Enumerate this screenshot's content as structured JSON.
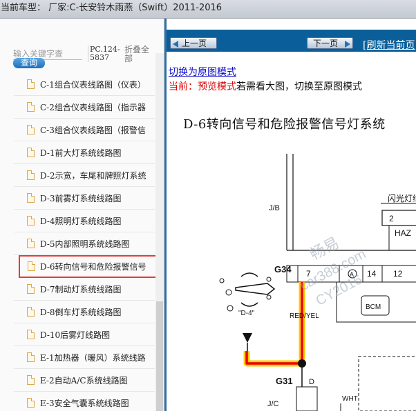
{
  "title_bar": {
    "text": "当前车型：  厂家:C-长安铃木雨燕（Swift）2011-2016"
  },
  "search": {
    "placeholder": "输入关键字查",
    "button_label": "查询",
    "pc_code": "PC.124-5837",
    "collapse_label": "折叠全部"
  },
  "tree": {
    "items": [
      {
        "label": "C-1组合仪表线路图（仪表）"
      },
      {
        "label": "C-2组合仪表线路图（指示器"
      },
      {
        "label": "C-3组合仪表线路图（报警信"
      },
      {
        "label": "D-1前大灯系统线路图"
      },
      {
        "label": "D-2示宽，车尾和牌照灯系统"
      },
      {
        "label": "D-3前雾灯系统线路图"
      },
      {
        "label": "D-4照明灯系统线路图"
      },
      {
        "label": "D-5内部照明系统线路图"
      },
      {
        "label": "D-6转向信号和危险报警信号",
        "selected": true
      },
      {
        "label": "D-7制动灯系统线路图"
      },
      {
        "label": "D-8倒车灯系统线路图"
      },
      {
        "label": "D-10后雾灯线路图"
      },
      {
        "label": "E-1加热器（暖风）系统线路"
      },
      {
        "label": "E-2自动A/C系统线路图"
      },
      {
        "label": "E-3安全气囊系统线路图"
      }
    ]
  },
  "viewer": {
    "prev_label": "上一页",
    "next_label": "下一页",
    "refresh_label": "[刷新当前页",
    "switch_link": "切换为原图模式",
    "mode_prefix": "当前：",
    "mode_name": "预览模式",
    "mode_hint": "若需看大图，切换至原图模式",
    "diagram_title": "D-6转向信号和危险报警信号灯系统",
    "diagram_labels": {
      "jb": "J/B",
      "g34": "G34",
      "g34_pin": "7",
      "pin_a": "A",
      "pin14": "14",
      "pin12": "12",
      "pin2": "2",
      "haz": "HAZ",
      "flasher": "闪光灯继",
      "bcm": "BCM",
      "wire_color": "RED/YEL",
      "d4_ref": "\"D-4\"",
      "g31": "G31",
      "g31_pin": "D",
      "jc": "J/C",
      "wht": "WHT"
    },
    "watermark": [
      "畅易",
      "car388.com",
      "CY2016"
    ]
  },
  "colors": {
    "nav_bar": "#0a5f9a",
    "selected_outline": "#e53b3b",
    "harness_highlight": "#ffcc00",
    "harness_core": "#e8000b"
  }
}
